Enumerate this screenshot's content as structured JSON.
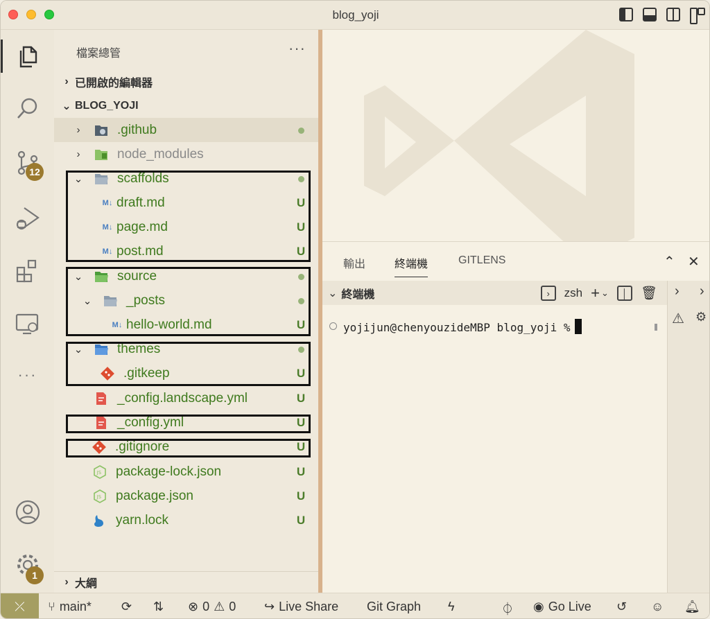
{
  "window": {
    "title": "blog_yoji"
  },
  "activity_bar": {
    "items": [
      {
        "name": "explorer",
        "icon": "files-icon"
      },
      {
        "name": "search",
        "icon": "search-icon"
      },
      {
        "name": "source-control",
        "icon": "source-control-icon",
        "badge": "12"
      },
      {
        "name": "run-debug",
        "icon": "run-debug-icon"
      },
      {
        "name": "extensions",
        "icon": "extensions-icon"
      },
      {
        "name": "remote-explorer",
        "icon": "remote-explorer-icon"
      },
      {
        "name": "more",
        "icon": "more-icon"
      }
    ],
    "accounts_icon": "account-icon",
    "manage_badge": "1"
  },
  "sidebar": {
    "title": "檔案總管",
    "more": "···",
    "open_editors": "已開啟的編輯器",
    "project": "BLOG_YOJI",
    "outline": "大綱",
    "tree": [
      {
        "name": ".github",
        "status": "dot"
      },
      {
        "name": "node_modules",
        "status": ""
      },
      {
        "name": "scaffolds",
        "status": "dot"
      },
      {
        "name": "draft.md",
        "status": "U"
      },
      {
        "name": "page.md",
        "status": "U"
      },
      {
        "name": "post.md",
        "status": "U"
      },
      {
        "name": "source",
        "status": "dot"
      },
      {
        "name": "_posts",
        "status": "dot"
      },
      {
        "name": "hello-world.md",
        "status": "U"
      },
      {
        "name": "themes",
        "status": "dot"
      },
      {
        "name": ".gitkeep",
        "status": "U"
      },
      {
        "name": "_config.landscape.yml",
        "status": "U"
      },
      {
        "name": "_config.yml",
        "status": "U"
      },
      {
        "name": ".gitignore",
        "status": "U"
      },
      {
        "name": "package-lock.json",
        "status": "U"
      },
      {
        "name": "package.json",
        "status": "U"
      },
      {
        "name": "yarn.lock",
        "status": "U"
      }
    ]
  },
  "panel": {
    "tabs": [
      "輸出",
      "終端機",
      "GITLENS"
    ],
    "active_tab": "終端機",
    "terminal_header": "終端機",
    "shell": "zsh",
    "prompt": "yojijun@chenyouzideMBP blog_yoji %"
  },
  "status_bar": {
    "branch": "main*",
    "errors": "0",
    "warnings": "0",
    "live_share": "Live Share",
    "git_graph": "Git Graph",
    "go_live": "Go Live"
  },
  "colors": {
    "git_added": "#4b7c2a",
    "untracked_text": "#3f7a1e",
    "badge": "#9b7a2f",
    "sash": "#d8b28c"
  }
}
